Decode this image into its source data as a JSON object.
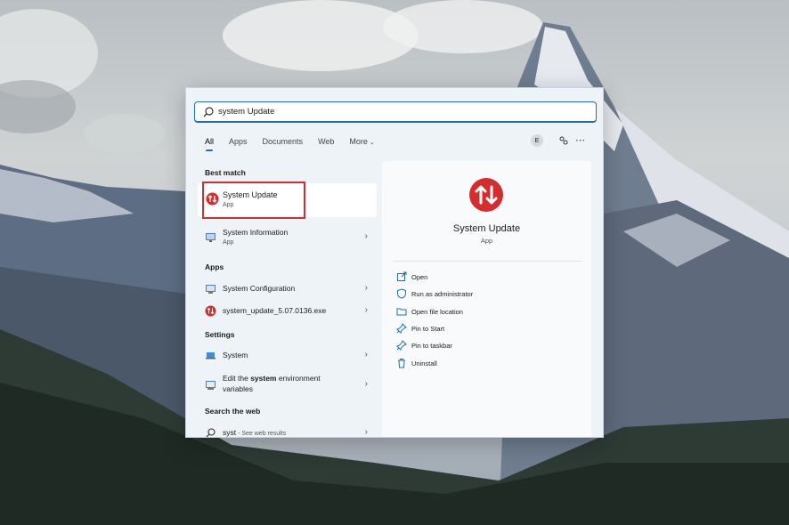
{
  "search": {
    "value": "system Update"
  },
  "tabs": [
    "All",
    "Apps",
    "Documents",
    "Web",
    "More"
  ],
  "avatar_letter": "E",
  "sections": {
    "best_match": "Best match",
    "apps": "Apps",
    "settings": "Settings",
    "web": "Search the web"
  },
  "best_match": {
    "name": "System Update",
    "kind": "App"
  },
  "results": {
    "sysinfo": {
      "name": "System Information",
      "kind": "App"
    },
    "sysconfig": "System Configuration",
    "exe": "system_update_5.07.0136.exe",
    "system": "System",
    "env_line1_pre": "Edit the ",
    "env_line1_bold": "system",
    "env_line1_post": " environment",
    "env_line2": "variables",
    "web_query": "syst",
    "web_sub": " - See web results"
  },
  "detail": {
    "title": "System Update",
    "kind": "App",
    "actions": [
      "Open",
      "Run as administrator",
      "Open file location",
      "Pin to Start",
      "Pin to taskbar",
      "Uninstall"
    ]
  },
  "colors": {
    "accent": "#1f6fb5",
    "app_red": "#d32d2f",
    "highlight_box": "#d32d2f"
  }
}
